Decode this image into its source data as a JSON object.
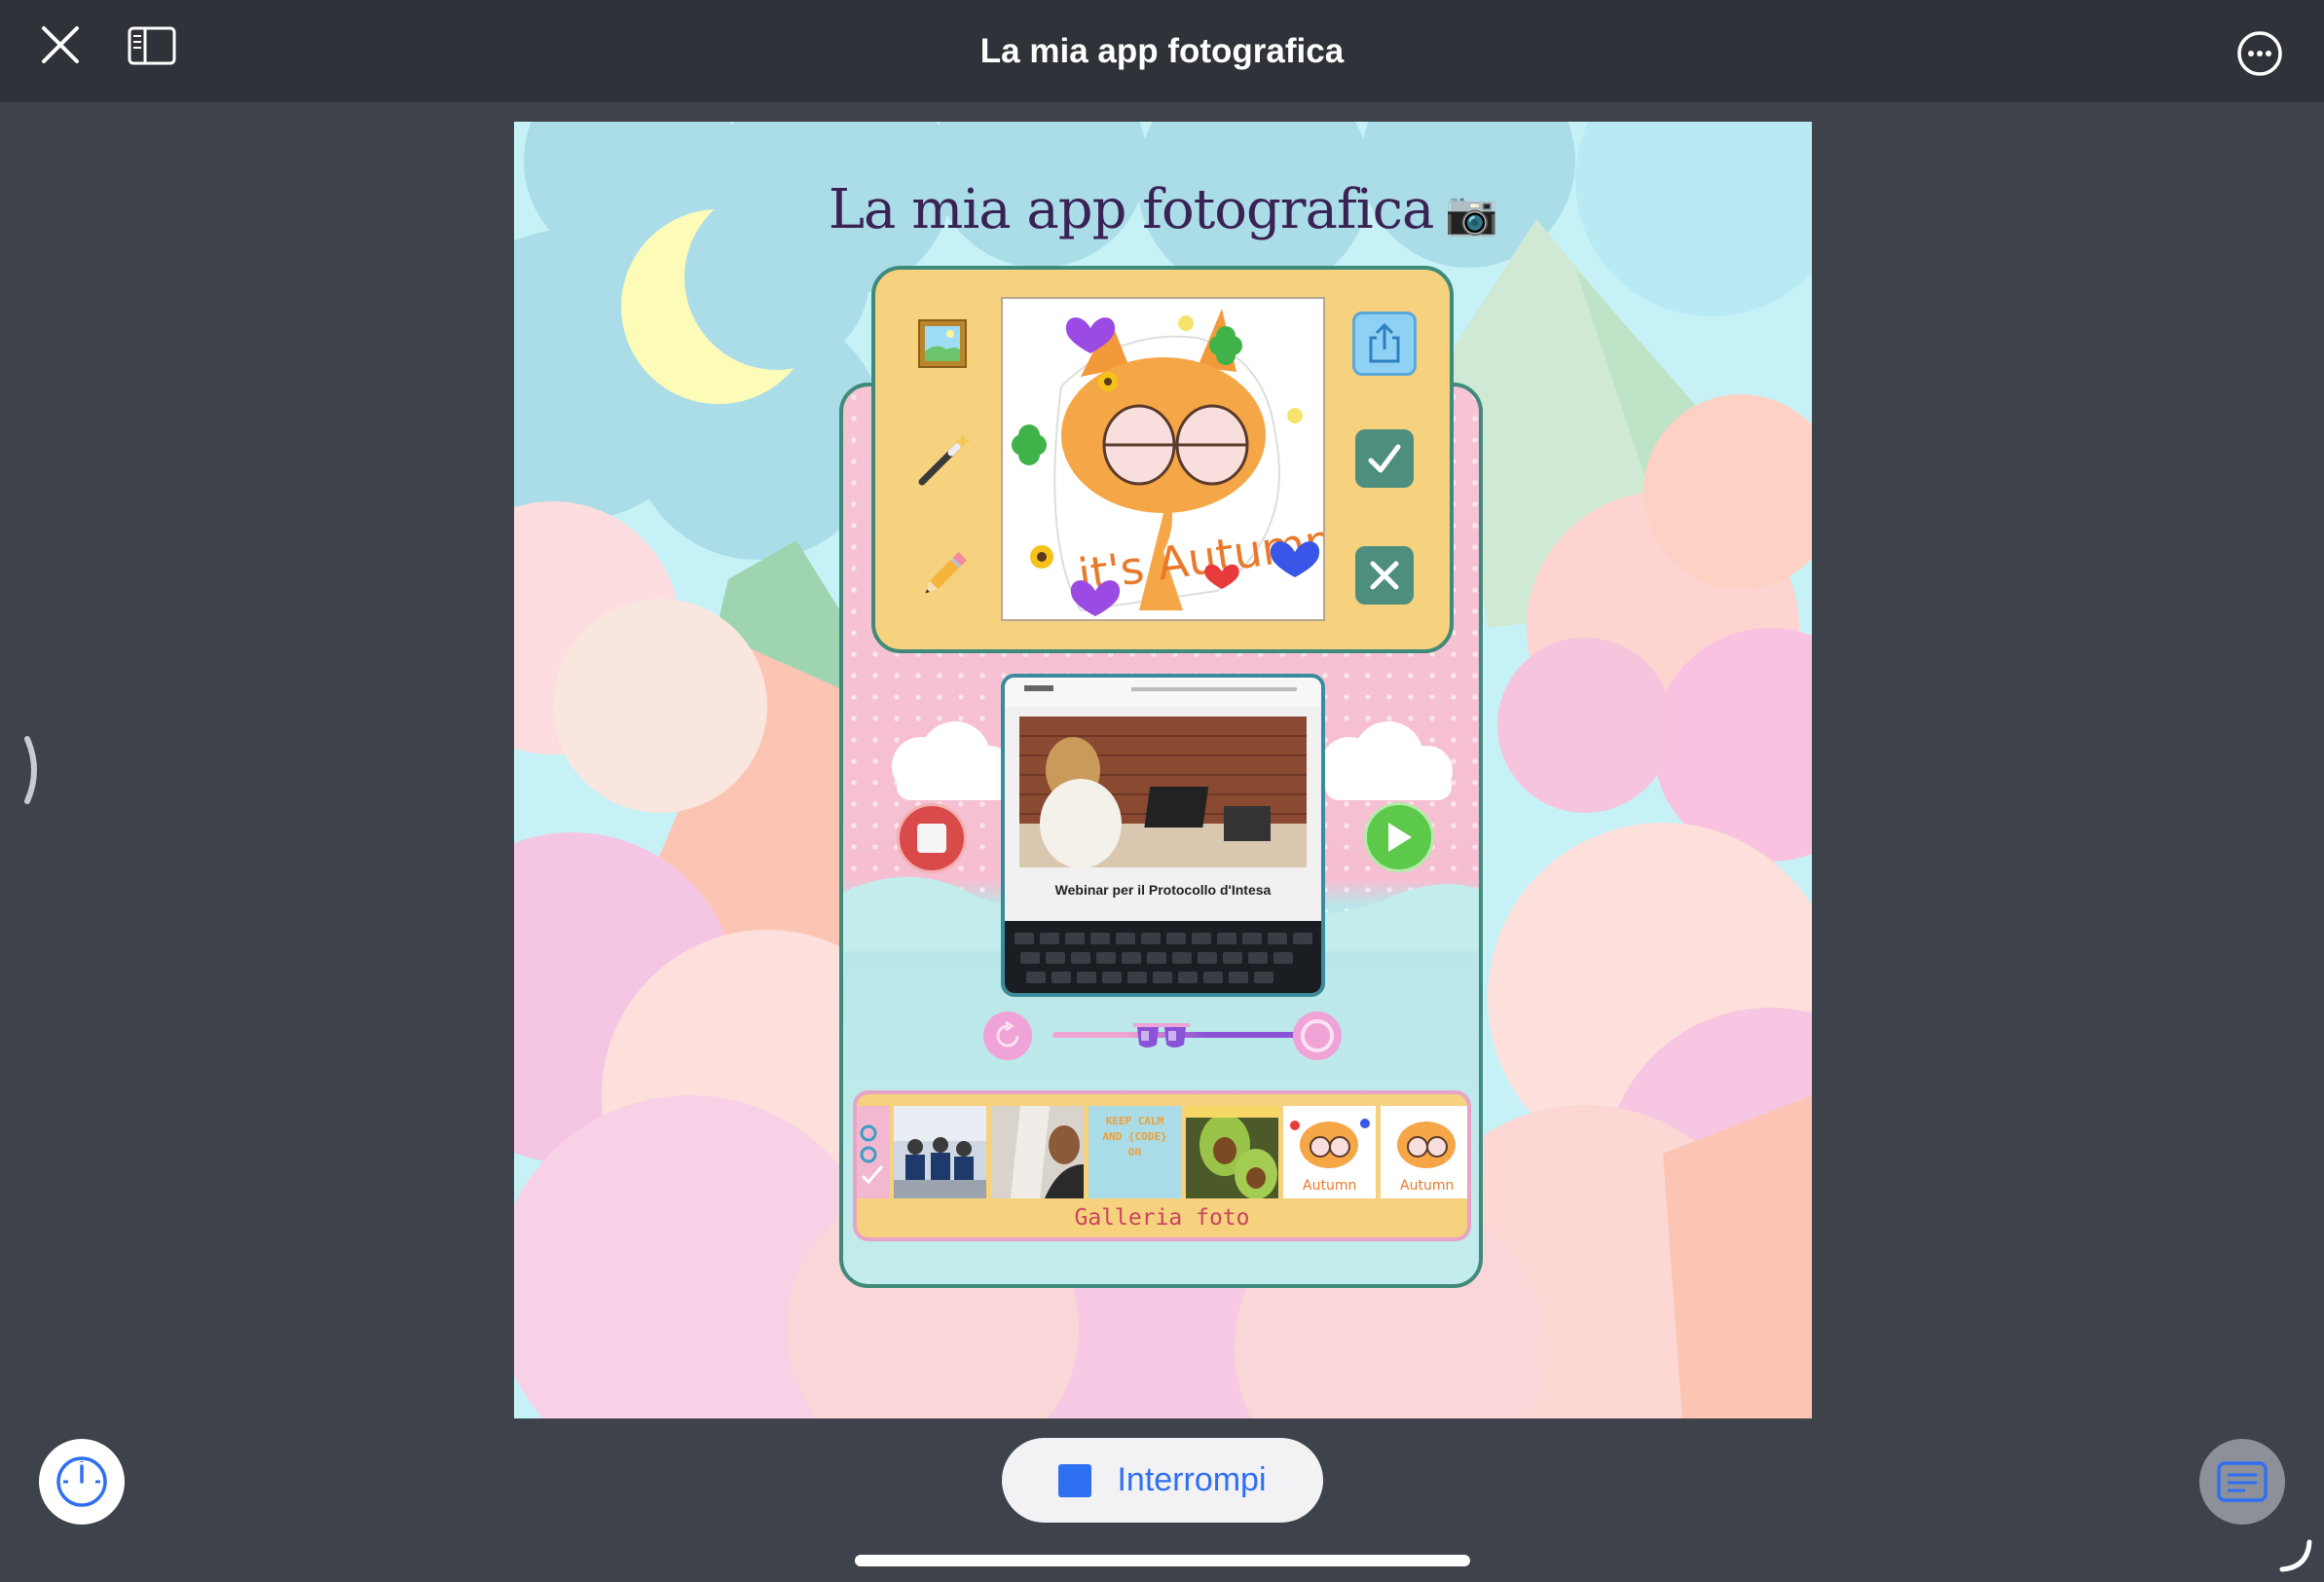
{
  "window": {
    "title": "La mia app fotografica"
  },
  "icons": {
    "close": "close-icon",
    "sidebar": "sidebar-icon",
    "more": "more-icon",
    "chevron": "chevron-right-icon",
    "gauge": "gauge-icon",
    "notes": "notes-icon"
  },
  "app": {
    "title": "La mia app fotografica",
    "title_emoji": "📷",
    "tools": [
      "picture-frame",
      "magic-wand",
      "pencil"
    ],
    "actions": [
      "share",
      "confirm",
      "cancel"
    ],
    "video_caption": "Webinar per il Protocollo d'Intesa",
    "gallery_label": "Galleria foto",
    "gallery_thumbs": [
      "classroom",
      "person",
      "keep-calm",
      "avocado",
      "cat-sticker-1",
      "cat-sticker-2"
    ],
    "thumb_text": {
      "keep_calm": "KEEP CALM AND {CODE} ON"
    }
  },
  "bottom": {
    "stop_label": "Interrompi"
  },
  "colors": {
    "accent": "#2f6ff2",
    "topbar": "#2f3238",
    "background": "#3e424a",
    "panel_yellow": "#f6d17e",
    "panel_border": "#3f8a7a"
  }
}
